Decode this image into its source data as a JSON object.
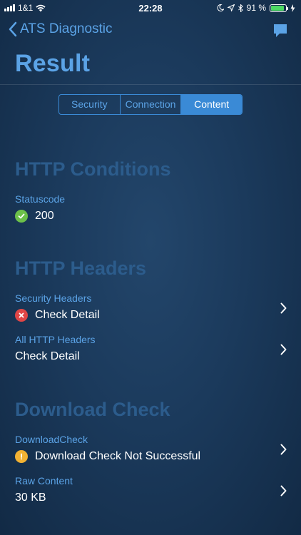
{
  "status_bar": {
    "carrier": "1&1",
    "time": "22:28",
    "battery": "91 %",
    "battery_level": 0.91
  },
  "nav": {
    "back_label": "ATS Diagnostic",
    "title": "Result"
  },
  "tabs": [
    {
      "label": "Security",
      "active": false
    },
    {
      "label": "Connection",
      "active": false
    },
    {
      "label": "Content",
      "active": true
    }
  ],
  "sections": {
    "http_conditions": {
      "title": "HTTP Conditions",
      "statuscode": {
        "label": "Statuscode",
        "value": "200",
        "status": "ok"
      }
    },
    "http_headers": {
      "title": "HTTP Headers",
      "security_headers": {
        "label": "Security Headers",
        "value": "Check Detail",
        "status": "error"
      },
      "all_http_headers": {
        "label": "All HTTP Headers",
        "value": "Check Detail"
      }
    },
    "download_check": {
      "title": "Download Check",
      "download_check": {
        "label": "DownloadCheck",
        "value": "Download Check Not Successful",
        "status": "warning"
      },
      "raw_content": {
        "label": "Raw Content",
        "value": "30 KB"
      }
    }
  },
  "colors": {
    "accent": "#5ba3e6",
    "heading": "#2c5c8c",
    "ok": "#6cc04a",
    "error": "#e04646",
    "warning": "#f2b233"
  }
}
